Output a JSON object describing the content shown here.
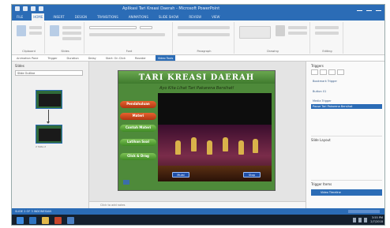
{
  "window": {
    "title": "Aplikasi Tari Kreasi Daerah - Microsoft PowerPoint"
  },
  "ribbon": {
    "tabs": [
      "FILE",
      "HOME",
      "INSERT",
      "DESIGN",
      "TRANSITIONS",
      "ANIMATIONS",
      "SLIDE SHOW",
      "REVIEW",
      "VIEW"
    ],
    "active_tab": "HOME",
    "groups": [
      "Clipboard",
      "Slides",
      "Font",
      "Paragraph",
      "Drawing",
      "Editing"
    ]
  },
  "animation_strip": {
    "items": [
      "Animation Pane",
      "Trigger",
      "Duration",
      "Delay",
      "Start: On Click",
      "Reorder"
    ],
    "highlight": "Video Tools"
  },
  "left_pane": {
    "heading": "Slides",
    "dropdown": "Slide Outline",
    "thumb_caption": "2  Slide 2"
  },
  "slide": {
    "title": "TARI KREASI DAERAH",
    "subtitle": "Ayo Kita Lihat Tari Pakarena Bersihat!",
    "menu": [
      {
        "label": "Pendahuluan",
        "color": "red"
      },
      {
        "label": "Materi",
        "color": "red"
      },
      {
        "label": "Contoh Materi",
        "color": "grn"
      },
      {
        "label": "Latihan Soal",
        "color": "grn"
      },
      {
        "label": "Click & Drag",
        "color": "grn"
      }
    ],
    "video_buttons": {
      "play": "Mulai",
      "stop": "Stop"
    }
  },
  "notes": {
    "placeholder": "Click to add notes"
  },
  "right_pane": {
    "heading": "Triggers",
    "triggers": [
      "Bookmark Trigger",
      "Button 01",
      "Media Trigger",
      "Pause Tari Pakarena Bersihat"
    ],
    "section": "Slide Layout",
    "bottom_heading": "Trigger Items",
    "bottom_bar": "Video Timeline"
  },
  "status_bar": {
    "text": "SLIDE 2 OF 3    INDONESIAN"
  },
  "taskbar": {
    "time": "3:55 PM",
    "date": "2/7/2018"
  },
  "colors": {
    "accent": "#2b6cb6",
    "slide_bg": "#4e8a3a",
    "menu_red": "#d94f22",
    "menu_green": "#5aa838"
  }
}
